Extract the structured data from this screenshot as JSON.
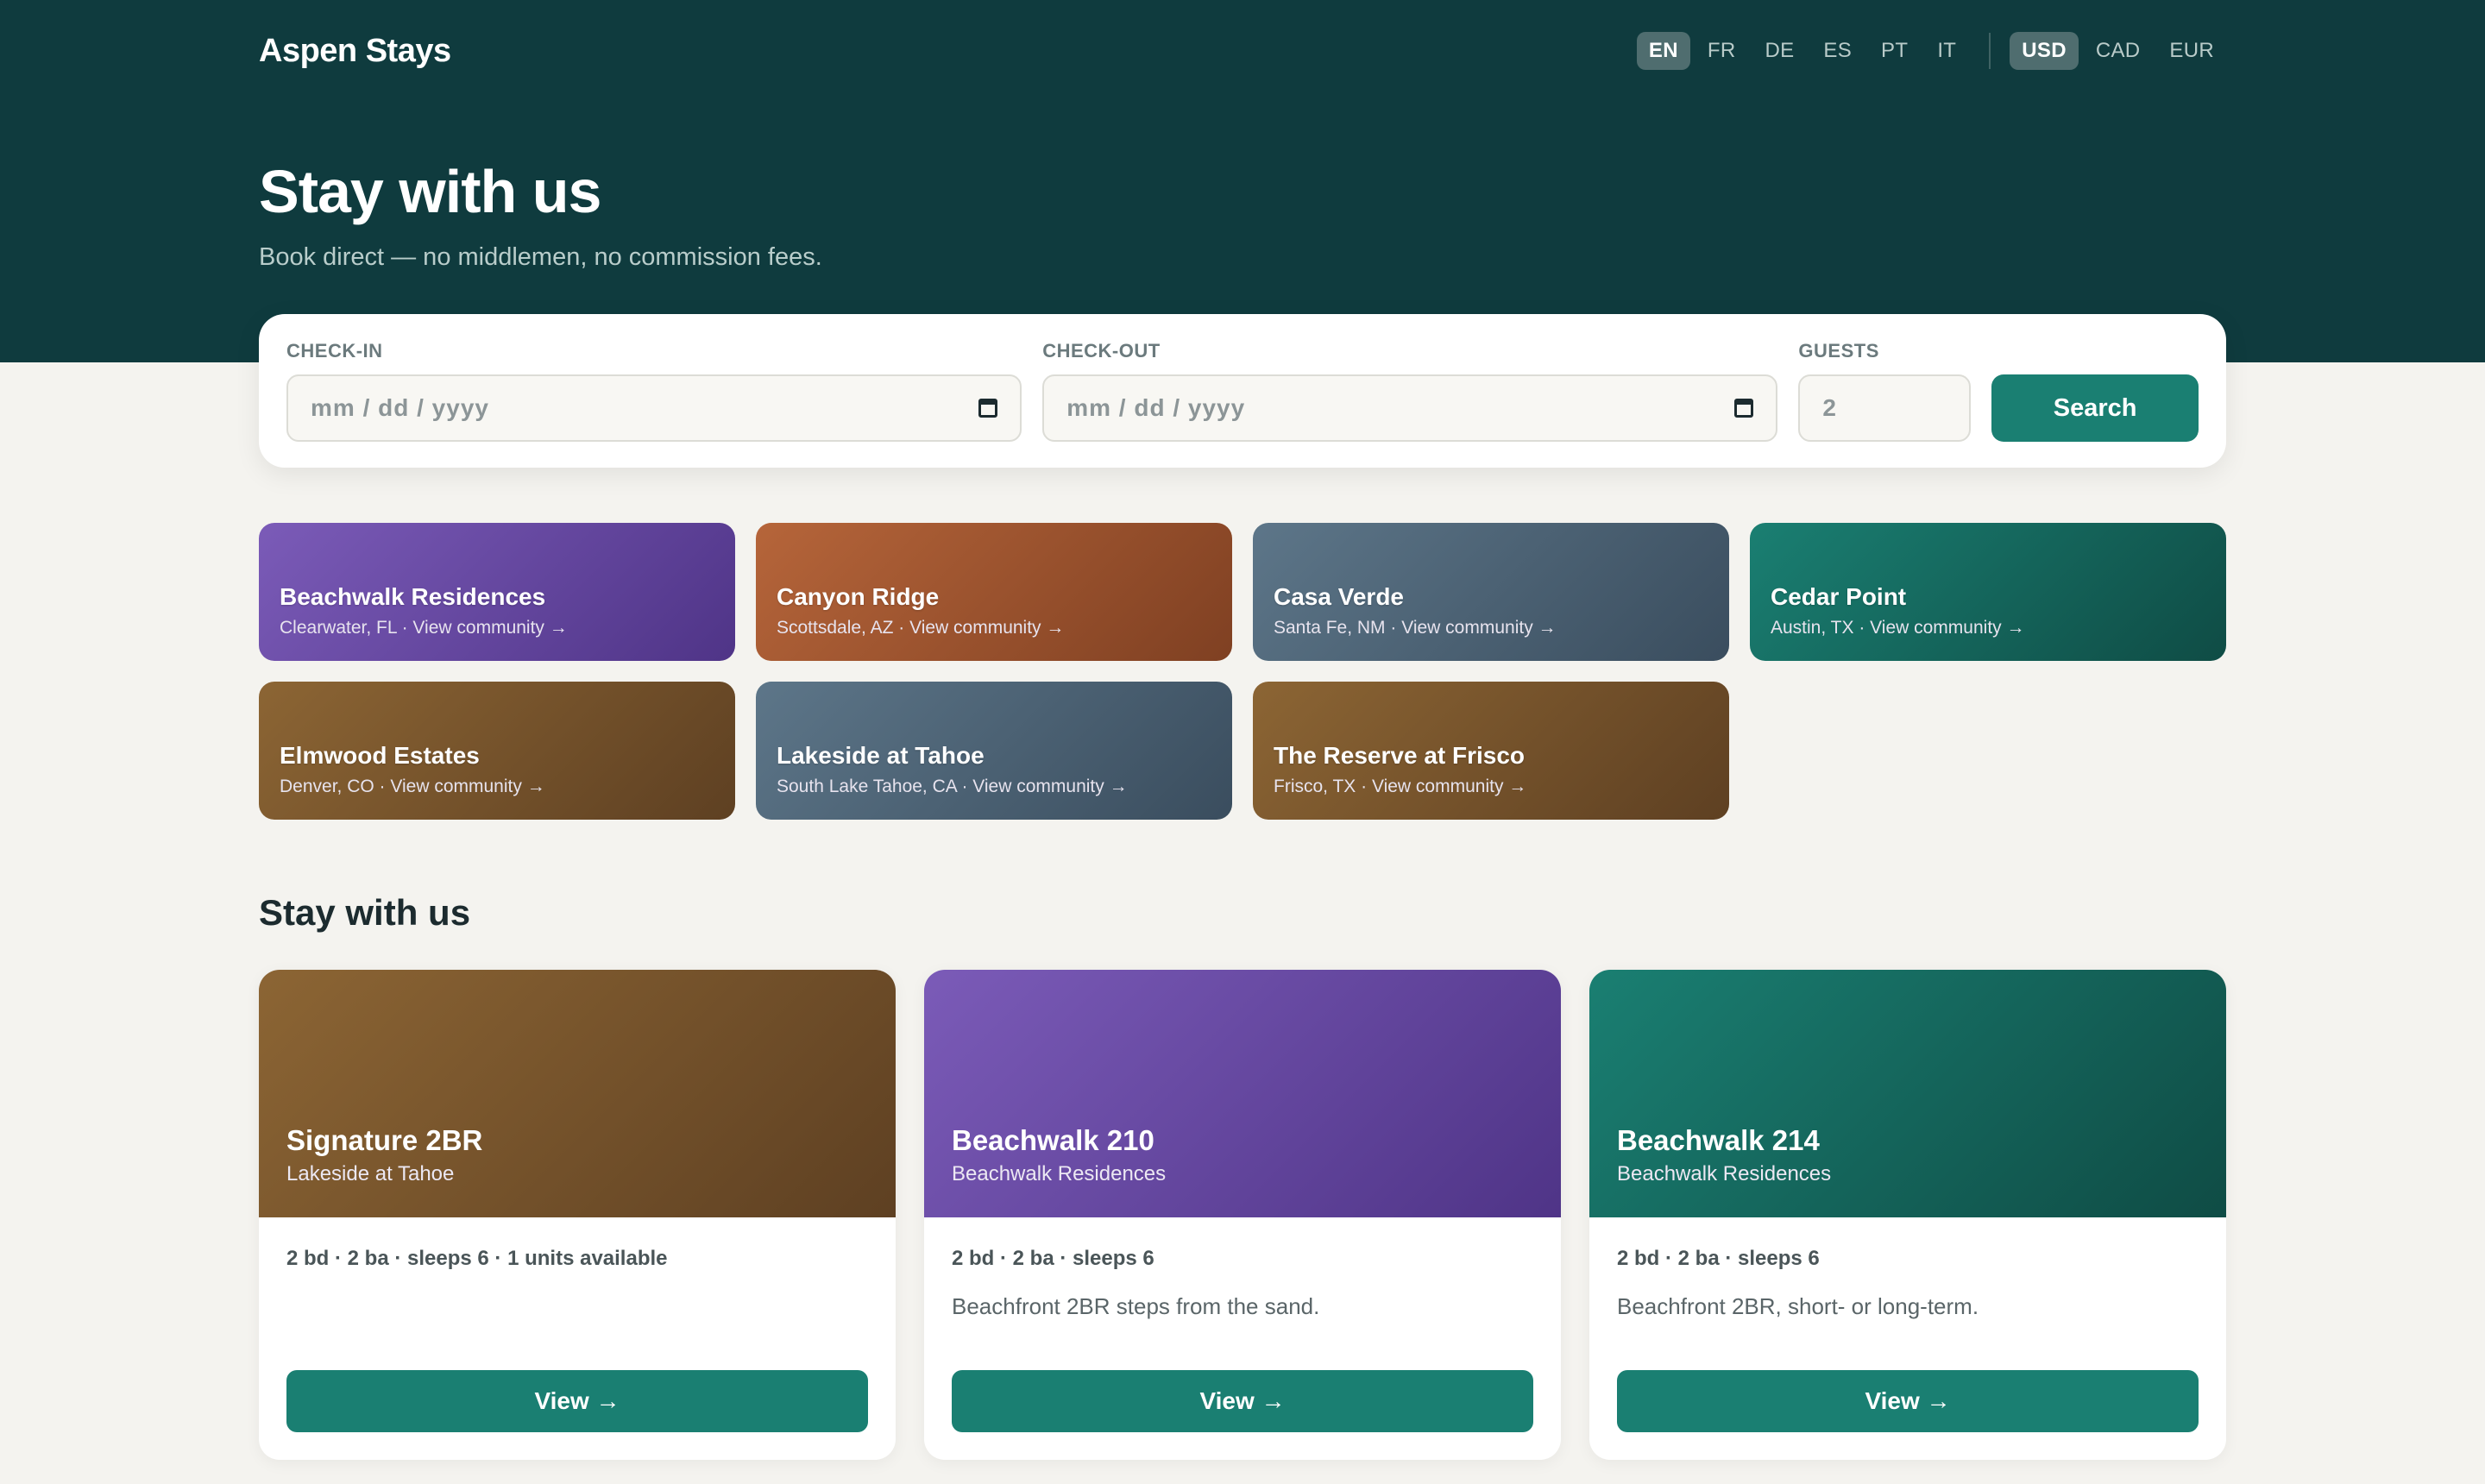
{
  "header": {
    "brand": "Aspen Stays",
    "languages": [
      "EN",
      "FR",
      "DE",
      "ES",
      "PT",
      "IT"
    ],
    "active_language": "EN",
    "currencies": [
      "USD",
      "CAD",
      "EUR"
    ],
    "active_currency": "USD"
  },
  "hero": {
    "title": "Stay with us",
    "subtitle": "Book direct — no middlemen, no commission fees."
  },
  "search": {
    "checkin_label": "CHECK-IN",
    "checkin_placeholder": "mm / dd / yyyy",
    "checkout_label": "CHECK-OUT",
    "checkout_placeholder": "mm / dd / yyyy",
    "guests_label": "GUESTS",
    "guests_value": "2",
    "button": "Search"
  },
  "communities": [
    {
      "name": "Beachwalk Residences",
      "meta": "Clearwater, FL · View community →",
      "color": "#6a4aa6"
    },
    {
      "name": "Canyon Ridge",
      "meta": "Scottsdale, AZ · View community →",
      "color": "#9c5330"
    },
    {
      "name": "Casa Verde",
      "meta": "Santa Fe, NM · View community →",
      "color": "#4c6375"
    },
    {
      "name": "Cedar Point",
      "meta": "Austin, TX · View community →",
      "color": "#156659"
    },
    {
      "name": "Elmwood Estates",
      "meta": "Denver, CO · View community →",
      "color": "#75532b"
    },
    {
      "name": "Lakeside at Tahoe",
      "meta": "South Lake Tahoe, CA · View community →",
      "color": "#4c6375"
    },
    {
      "name": "The Reserve at Frisco",
      "meta": "Frisco, TX · View community →",
      "color": "#75532b"
    }
  ],
  "listings_section": {
    "title": "Stay with us",
    "listings": [
      {
        "name": "Signature 2BR",
        "community": "Lakeside at Tahoe",
        "specs": "2 bd · 2 ba · sleeps 6 · 1 units available",
        "description": "",
        "button": "View →",
        "color": "#75532b"
      },
      {
        "name": "Beachwalk 210",
        "community": "Beachwalk Residences",
        "specs": "2 bd · 2 ba · sleeps 6",
        "description": "Beachfront 2BR steps from the sand.",
        "button": "View →",
        "color": "#6a4aa6"
      },
      {
        "name": "Beachwalk 214",
        "community": "Beachwalk Residences",
        "specs": "2 bd · 2 ba · sleeps 6",
        "description": "Beachfront 2BR, short- or long-term.",
        "button": "View →",
        "color": "#156659"
      }
    ]
  }
}
